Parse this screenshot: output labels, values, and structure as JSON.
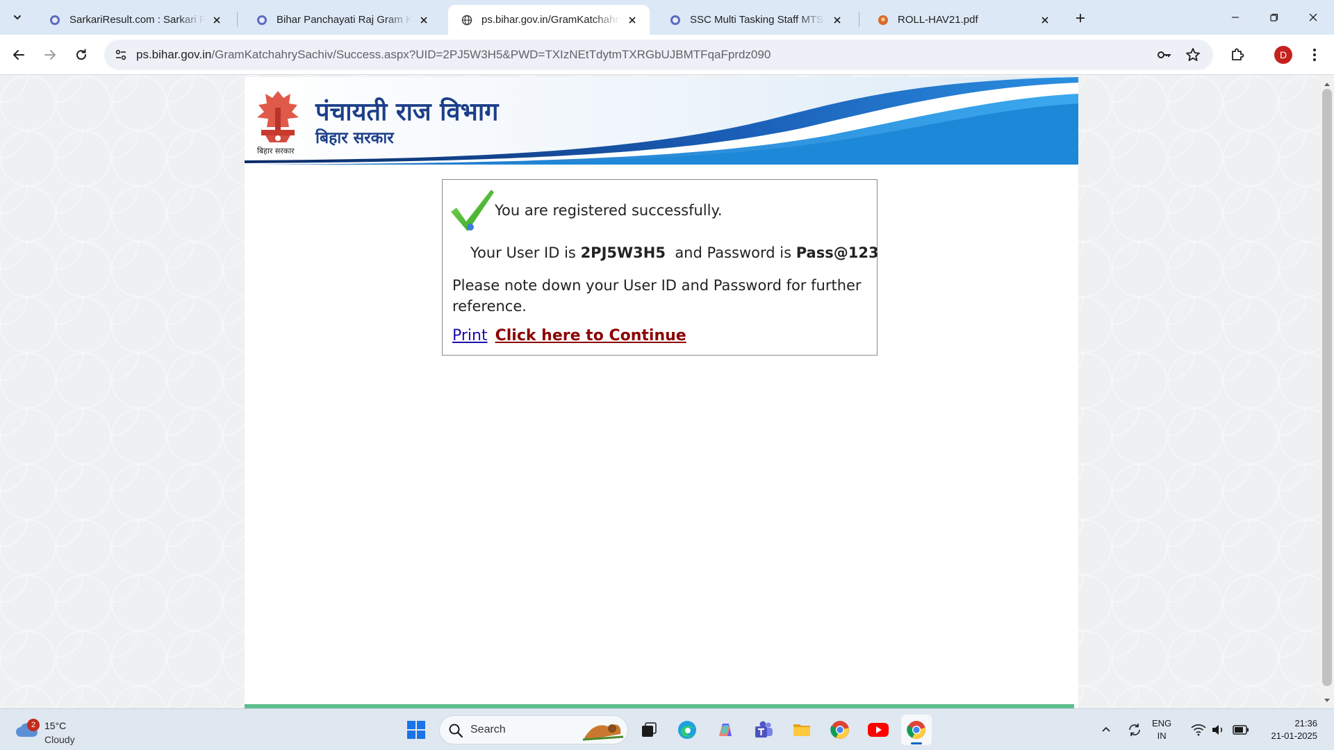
{
  "browser": {
    "tabs": [
      {
        "title": "SarkariResult.com : Sarkari Result",
        "active": false
      },
      {
        "title": "Bihar Panchayati Raj Gram Katchahry",
        "active": false
      },
      {
        "title": "ps.bihar.gov.in/GramKatchahrySachiv",
        "active": true
      },
      {
        "title": "SSC Multi Tasking Staff MTS and Havaldar",
        "active": false
      },
      {
        "title": "ROLL-HAV21.pdf",
        "active": false
      }
    ],
    "url_host": "ps.bihar.gov.in",
    "url_path": "/GramKatchahrySachiv/Success.aspx?UID=2PJ5W3H5&PWD=TXIzNEtTdytmTXRGbUJBMTFqaFprdz090",
    "profile_initial": "D"
  },
  "page": {
    "banner": {
      "dept_title": "पंचायती राज विभाग",
      "state_title": "बिहार सरकार",
      "emblem_label": "बिहार सरकार"
    },
    "success": {
      "message": "You are registered successfully.",
      "user_id_prefix": "Your User ID is",
      "user_id": "2PJ5W3H5",
      "password_prefix": "and Password is",
      "password": "Pass@123",
      "note": "Please note down your User ID and Password for further reference.",
      "print_link": "Print",
      "continue_link": "Click here to Continue"
    }
  },
  "taskbar": {
    "weather_badge": "2",
    "temperature": "15°C",
    "condition": "Cloudy",
    "search_placeholder": "Search",
    "language_top": "ENG",
    "language_bottom": "IN",
    "time": "21:36",
    "date": "21-01-2025"
  },
  "colors": {
    "banner_dark_blue": "#1c3f8a",
    "banner_swoosh_blue": "#1b6fc2",
    "link_blue": "#1a0dab",
    "link_dark_red": "#8b0000",
    "footer_green": "#5cbf8f",
    "tick_green": "#4cbb17",
    "tabstrip_bg": "#dce8f6"
  }
}
